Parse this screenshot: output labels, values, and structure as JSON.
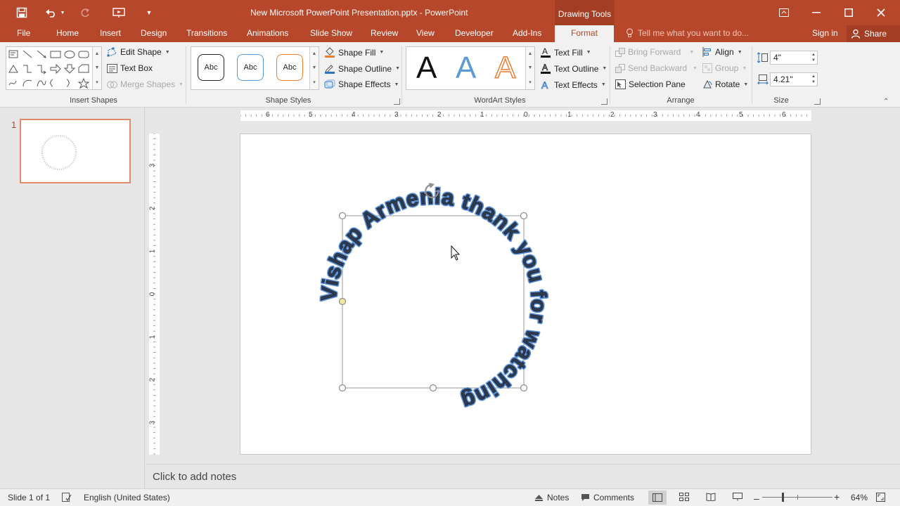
{
  "titlebar": {
    "title": "New Microsoft PowerPoint Presentation.pptx - PowerPoint",
    "contextual_tab_group": "Drawing Tools"
  },
  "tabs": [
    "File",
    "Home",
    "Insert",
    "Design",
    "Transitions",
    "Animations",
    "Slide Show",
    "Review",
    "View",
    "Developer",
    "Add-Ins",
    "Format"
  ],
  "active_tab": "Format",
  "tell_me_placeholder": "Tell me what you want to do...",
  "account": {
    "sign_in": "Sign in",
    "share": "Share"
  },
  "ribbon": {
    "insert_shapes": {
      "label": "Insert Shapes",
      "edit_shape": "Edit Shape",
      "text_box": "Text Box",
      "merge_shapes": "Merge Shapes"
    },
    "shape_styles": {
      "label": "Shape Styles",
      "presets": [
        "Abc",
        "Abc",
        "Abc"
      ],
      "preset_colors": [
        "#222222",
        "#5b9bd5",
        "#ed7d31"
      ],
      "shape_fill": "Shape Fill",
      "shape_outline": "Shape Outline",
      "shape_effects": "Shape Effects"
    },
    "wordart_styles": {
      "label": "WordArt Styles",
      "presets": [
        "A",
        "A",
        "A"
      ],
      "text_fill": "Text Fill",
      "text_outline": "Text Outline",
      "text_effects": "Text Effects"
    },
    "arrange": {
      "label": "Arrange",
      "bring_forward": "Bring Forward",
      "send_backward": "Send Backward",
      "selection_pane": "Selection Pane",
      "align": "Align",
      "group": "Group",
      "rotate": "Rotate"
    },
    "size": {
      "label": "Size",
      "height": "4\"",
      "width": "4.21\""
    }
  },
  "ruler": {
    "horizontal": [
      "6",
      "5",
      "4",
      "3",
      "2",
      "1",
      "0",
      "1",
      "2",
      "3",
      "4",
      "5",
      "6"
    ],
    "vertical": [
      "3",
      "2",
      "1",
      "0",
      "1",
      "2",
      "3"
    ]
  },
  "thumbnails": [
    {
      "number": "1"
    }
  ],
  "slide": {
    "wordart_text": "Vishap Armenia thank you for watching"
  },
  "notes_placeholder": "Click to add notes",
  "statusbar": {
    "slide_info": "Slide 1 of 1",
    "language": "English (United States)",
    "notes": "Notes",
    "comments": "Comments",
    "zoom": "64%"
  },
  "colors": {
    "accent": "#b7472a",
    "accent_dark": "#a33d24"
  }
}
